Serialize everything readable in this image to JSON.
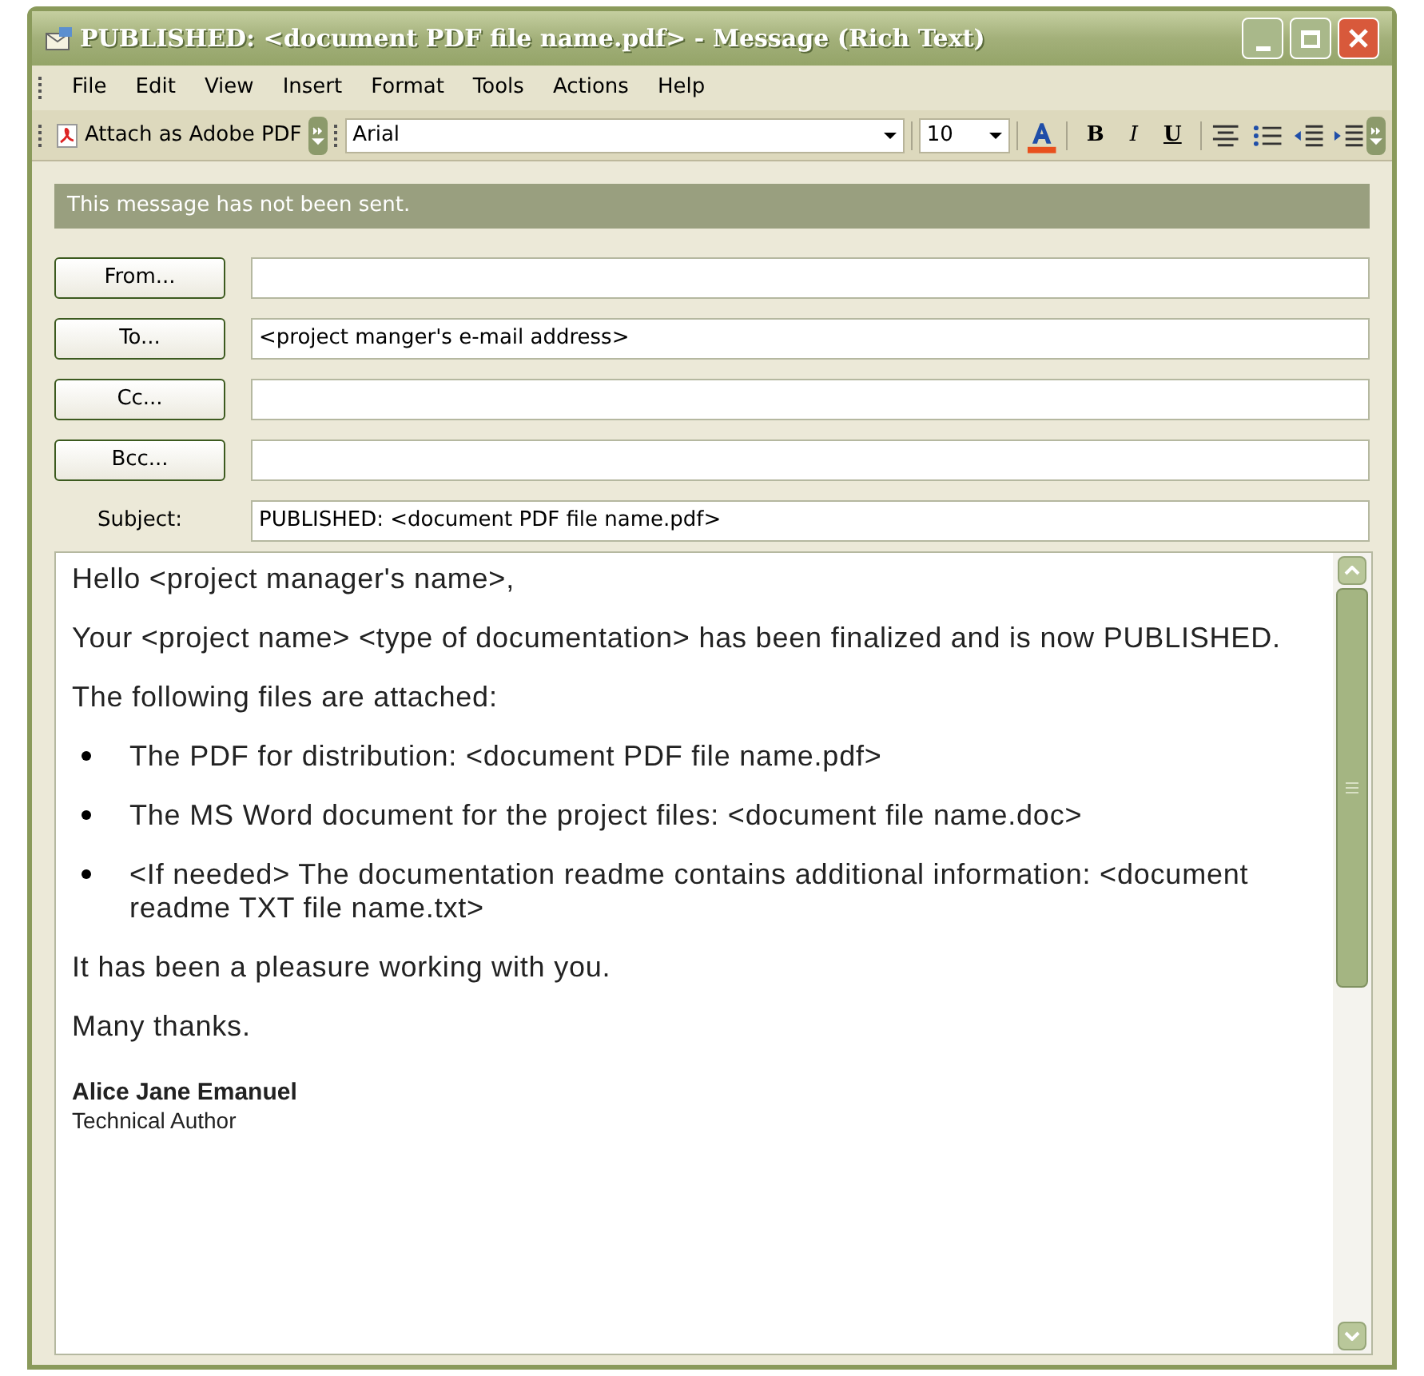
{
  "window": {
    "title": "PUBLISHED: <document PDF file name.pdf> - Message (Rich Text)"
  },
  "menu": [
    "File",
    "Edit",
    "View",
    "Insert",
    "Format",
    "Tools",
    "Actions",
    "Help"
  ],
  "toolbar": {
    "attach_button": "Attach as Adobe PDF",
    "font": "Arial",
    "size": "10",
    "bold": "B",
    "italic": "I",
    "underline": "U"
  },
  "info_bar": "This message has not been sent.",
  "fields": [
    {
      "kind": "button",
      "label": "From..."
    },
    {
      "kind": "button",
      "label": "To...",
      "value": "<project manger's e-mail address>"
    },
    {
      "kind": "button",
      "label": "Cc..."
    },
    {
      "kind": "button",
      "label": "Bcc..."
    },
    {
      "kind": "label",
      "label": "Subject:",
      "value": "PUBLISHED: <document PDF file name.pdf>"
    }
  ],
  "body": [
    {
      "kind": "para",
      "text": "Hello <project manager's name>,"
    },
    {
      "kind": "para",
      "text": "Your <project name> <type of documentation> has been finalized and is now PUBLISHED."
    },
    {
      "kind": "para",
      "text": "The following files are attached:"
    },
    {
      "kind": "bullet",
      "text": "The PDF for distribution: <document PDF file name.pdf>"
    },
    {
      "kind": "bullet",
      "text": "The MS Word document for the project files: <document file name.doc>"
    },
    {
      "kind": "bullet",
      "text": "<If needed> The documentation readme contains additional information: <document readme TXT file name.txt>"
    },
    {
      "kind": "para",
      "text": "It has been a pleasure working with you."
    },
    {
      "kind": "para",
      "text": "Many thanks."
    },
    {
      "kind": "name",
      "text": "Alice Jane Emanuel"
    },
    {
      "kind": "role",
      "text": "Technical Author"
    }
  ]
}
